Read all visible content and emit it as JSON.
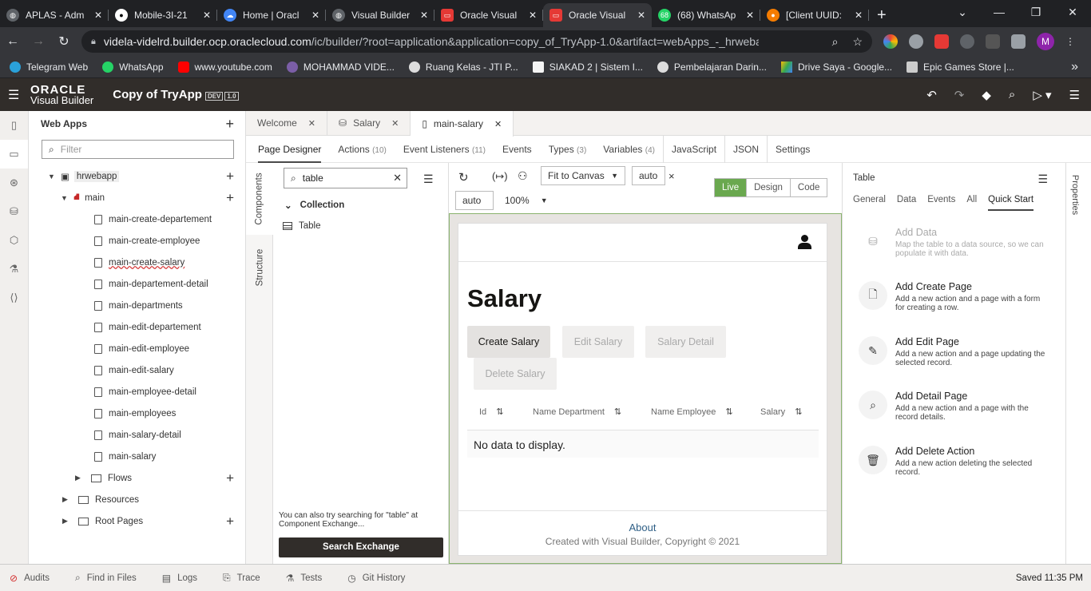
{
  "browser": {
    "tabs": [
      {
        "title": "APLAS - Adm",
        "icon": "globe-icon",
        "color": "#8ab4f8"
      },
      {
        "title": "Mobile-3I-21",
        "icon": "github-icon",
        "color": "#ffffff"
      },
      {
        "title": "Home | Oracl",
        "icon": "cloud-icon",
        "color": "#4285f4"
      },
      {
        "title": "Visual Builder",
        "icon": "globe-icon",
        "color": "#8ab4f8"
      },
      {
        "title": "Oracle Visual",
        "icon": "oracle-icon",
        "color": "#e53935"
      },
      {
        "title": "Oracle Visual",
        "icon": "oracle-icon",
        "color": "#e53935",
        "active": true
      },
      {
        "title": "(68) WhatsAp",
        "icon": "whatsapp-icon",
        "color": "#25d366"
      },
      {
        "title": "[Client UUID:",
        "icon": "extension-icon",
        "color": "#f57c00"
      }
    ],
    "close_glyph": "✕",
    "new_tab_glyph": "+",
    "url_host": "videla-videlrd.builder.ocp.oraclecloud.com",
    "url_path": "/ic/builder/?root=application&application=copy_of_TryApp-1.0&artifact=webApps_-_hrwebapp_-_fl...",
    "profile_initial": "M",
    "bookmarks": [
      {
        "label": "Telegram Web",
        "color": "#2aa1da"
      },
      {
        "label": "WhatsApp",
        "color": "#25d366"
      },
      {
        "label": "www.youtube.com",
        "color": "#ff0000"
      },
      {
        "label": "MOHAMMAD VIDE...",
        "color": "#7b5ea7"
      },
      {
        "label": "Ruang Kelas - JTI P...",
        "color": "#dddddd"
      },
      {
        "label": "SIAKAD 2 | Sistem I...",
        "color": "#f4f4f4"
      },
      {
        "label": "Pembelajaran Darin...",
        "color": "#dddddd"
      },
      {
        "label": "Drive Saya - Google...",
        "color": "#fbbc04"
      },
      {
        "label": "Epic Games Store |...",
        "color": "#cccccc"
      }
    ],
    "more_glyph": "»"
  },
  "header": {
    "logo_top": "ORACLE",
    "logo_bottom": "Visual Builder",
    "app_title": "Copy of TryApp",
    "badge_env": "DEV",
    "badge_version": "1.0"
  },
  "apps_panel": {
    "title": "Web Apps",
    "filter_placeholder": "Filter",
    "tree": {
      "app": "hrwebapp",
      "flow": "main",
      "pages": [
        "main-create-departement",
        "main-create-employee",
        "main-create-salary",
        "main-departement-detail",
        "main-departments",
        "main-edit-departement",
        "main-edit-employee",
        "main-edit-salary",
        "main-employee-detail",
        "main-employees",
        "main-salary-detail",
        "main-salary"
      ],
      "flows": "Flows",
      "resources": "Resources",
      "root_pages": "Root Pages"
    }
  },
  "page_tabs": [
    {
      "label": "Welcome"
    },
    {
      "label": "Salary"
    },
    {
      "label": "main-salary",
      "active": true
    }
  ],
  "sub_tabs": [
    {
      "label": "Page Designer",
      "count": "",
      "active": true
    },
    {
      "label": "Actions",
      "count": "(10)"
    },
    {
      "label": "Event Listeners",
      "count": "(11)"
    },
    {
      "label": "Events",
      "count": ""
    },
    {
      "label": "Types",
      "count": "(3)"
    },
    {
      "label": "Variables",
      "count": "(4)"
    },
    {
      "label": "JavaScript",
      "count": ""
    },
    {
      "label": "JSON",
      "count": ""
    },
    {
      "label": "Settings",
      "count": ""
    }
  ],
  "vertical_tabs": {
    "components": "Components",
    "structure": "Structure"
  },
  "components": {
    "search_value": "table",
    "group": "Collection",
    "item": "Table",
    "exchange_note": "You can also try searching for \"table\" at Component Exchange...",
    "exchange_button": "Search Exchange"
  },
  "canvas_toolbar": {
    "fit": "Fit to Canvas",
    "width": "auto",
    "height": "auto",
    "zoom": "100%",
    "close_glyph": "×",
    "modes": [
      "Live",
      "Design",
      "Code"
    ],
    "active_mode": "Live"
  },
  "preview": {
    "title": "Salary",
    "buttons": [
      {
        "label": "Create Salary",
        "enabled": true
      },
      {
        "label": "Edit Salary",
        "enabled": false
      },
      {
        "label": "Salary Detail",
        "enabled": false
      },
      {
        "label": "Delete Salary",
        "enabled": false
      }
    ],
    "columns": [
      "Id",
      "Name Department",
      "Name Employee",
      "Salary"
    ],
    "sort_glyph": "⇅",
    "empty_text": "No data to display.",
    "footer_link": "About",
    "footer_text": "Created with Visual Builder, Copyright © 2021"
  },
  "properties": {
    "heading": "Table",
    "tabs": [
      "General",
      "Data",
      "Events",
      "All",
      "Quick Start"
    ],
    "active_tab": "Quick Start",
    "rail_label": "Properties",
    "actions": [
      {
        "title": "Add Data",
        "desc": "Map the table to a data source, so we can populate it with data.",
        "icon": "database-icon",
        "disabled": true
      },
      {
        "title": "Add Create Page",
        "desc": "Add a new action and a page with a form for creating a row.",
        "icon": "create-page-icon"
      },
      {
        "title": "Add Edit Page",
        "desc": "Add a new action and a page updating the selected record.",
        "icon": "edit-page-icon"
      },
      {
        "title": "Add Detail Page",
        "desc": "Add a new action and a page with the record details.",
        "icon": "detail-page-icon"
      },
      {
        "title": "Add Delete Action",
        "desc": "Add a new action deleting the selected record.",
        "icon": "trash-icon"
      }
    ]
  },
  "status_bar": {
    "items": [
      "Audits",
      "Find in Files",
      "Logs",
      "Trace",
      "Tests",
      "Git History"
    ],
    "saved": "Saved 11:35 PM"
  }
}
